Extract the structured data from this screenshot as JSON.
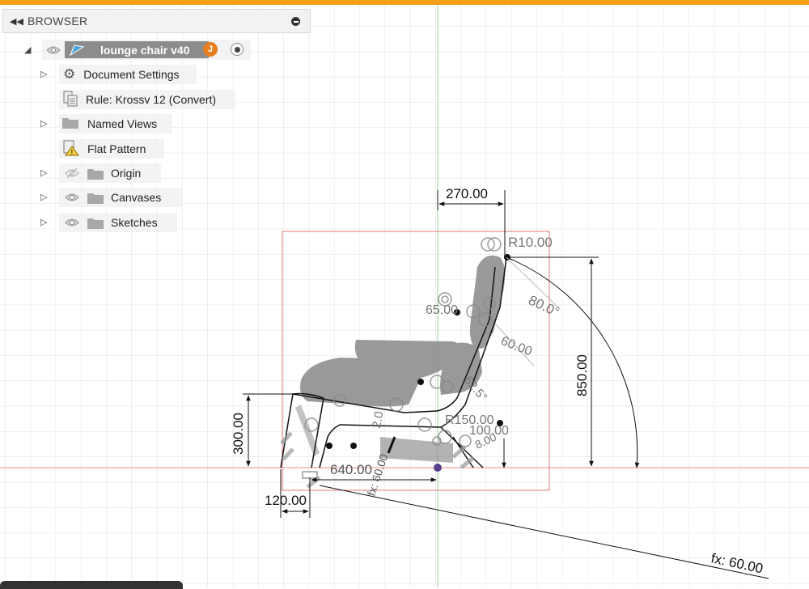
{
  "browser": {
    "title": "BROWSER",
    "root": {
      "label": "lounge chair v40",
      "avatar": "J"
    },
    "items": [
      {
        "label": "Document Settings",
        "icon": "gear-icon"
      },
      {
        "label": "Rule: Krossv 12 (Convert)",
        "icon": "sheet-metal-rule-icon"
      },
      {
        "label": "Named Views",
        "icon": "folder-icon"
      },
      {
        "label": "Flat Pattern",
        "icon": "flat-pattern-warning-icon"
      },
      {
        "label": "Origin",
        "icon": "folder-icon"
      },
      {
        "label": "Canvases",
        "icon": "folder-icon"
      },
      {
        "label": "Sketches",
        "icon": "folder-icon"
      }
    ]
  },
  "sketch": {
    "dimensions": {
      "d270": "270.00",
      "r10": "R10.00",
      "d65": "65.00",
      "a80": "80.0°",
      "d60": "60.00",
      "d850": "850.00",
      "d62_5": "62.5°",
      "r150": "R150.00",
      "d100": "100.00",
      "d8": "8.00",
      "d300": "300.00",
      "d640": "640.00",
      "d120": "120.00",
      "d2": "2.0",
      "fx60a": "fx: 60.00",
      "fx60b": "fx: 60.00"
    }
  },
  "colors": {
    "accent": "#f6a01a",
    "grid": "#e2e2e2",
    "x_axis": "#e88e8e",
    "y_axis": "#9fd29f"
  }
}
